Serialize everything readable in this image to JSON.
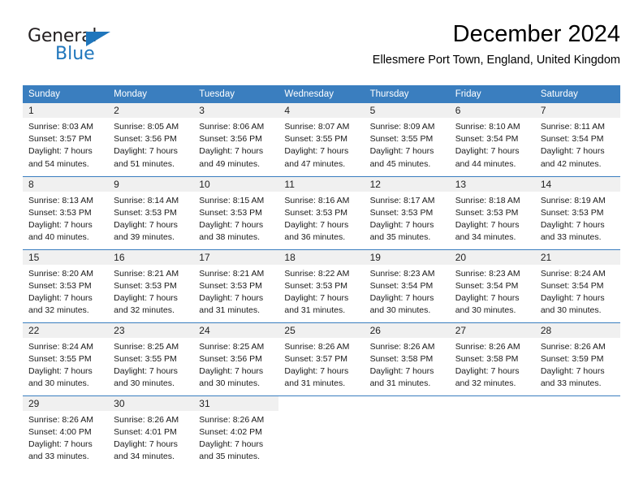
{
  "logo": {
    "word_dark": "General",
    "word_blue": "Blue",
    "accent_color": "#1f76bc"
  },
  "header": {
    "title": "December 2024",
    "subtitle": "Ellesmere Port Town, England, United Kingdom"
  },
  "calendar": {
    "header_bg": "#3a7ebf",
    "daynum_bg": "#f0f0f0",
    "weekdays": [
      "Sunday",
      "Monday",
      "Tuesday",
      "Wednesday",
      "Thursday",
      "Friday",
      "Saturday"
    ],
    "weeks": [
      [
        {
          "day": "1",
          "sunrise": "Sunrise: 8:03 AM",
          "sunset": "Sunset: 3:57 PM",
          "daylight1": "Daylight: 7 hours",
          "daylight2": "and 54 minutes."
        },
        {
          "day": "2",
          "sunrise": "Sunrise: 8:05 AM",
          "sunset": "Sunset: 3:56 PM",
          "daylight1": "Daylight: 7 hours",
          "daylight2": "and 51 minutes."
        },
        {
          "day": "3",
          "sunrise": "Sunrise: 8:06 AM",
          "sunset": "Sunset: 3:56 PM",
          "daylight1": "Daylight: 7 hours",
          "daylight2": "and 49 minutes."
        },
        {
          "day": "4",
          "sunrise": "Sunrise: 8:07 AM",
          "sunset": "Sunset: 3:55 PM",
          "daylight1": "Daylight: 7 hours",
          "daylight2": "and 47 minutes."
        },
        {
          "day": "5",
          "sunrise": "Sunrise: 8:09 AM",
          "sunset": "Sunset: 3:55 PM",
          "daylight1": "Daylight: 7 hours",
          "daylight2": "and 45 minutes."
        },
        {
          "day": "6",
          "sunrise": "Sunrise: 8:10 AM",
          "sunset": "Sunset: 3:54 PM",
          "daylight1": "Daylight: 7 hours",
          "daylight2": "and 44 minutes."
        },
        {
          "day": "7",
          "sunrise": "Sunrise: 8:11 AM",
          "sunset": "Sunset: 3:54 PM",
          "daylight1": "Daylight: 7 hours",
          "daylight2": "and 42 minutes."
        }
      ],
      [
        {
          "day": "8",
          "sunrise": "Sunrise: 8:13 AM",
          "sunset": "Sunset: 3:53 PM",
          "daylight1": "Daylight: 7 hours",
          "daylight2": "and 40 minutes."
        },
        {
          "day": "9",
          "sunrise": "Sunrise: 8:14 AM",
          "sunset": "Sunset: 3:53 PM",
          "daylight1": "Daylight: 7 hours",
          "daylight2": "and 39 minutes."
        },
        {
          "day": "10",
          "sunrise": "Sunrise: 8:15 AM",
          "sunset": "Sunset: 3:53 PM",
          "daylight1": "Daylight: 7 hours",
          "daylight2": "and 38 minutes."
        },
        {
          "day": "11",
          "sunrise": "Sunrise: 8:16 AM",
          "sunset": "Sunset: 3:53 PM",
          "daylight1": "Daylight: 7 hours",
          "daylight2": "and 36 minutes."
        },
        {
          "day": "12",
          "sunrise": "Sunrise: 8:17 AM",
          "sunset": "Sunset: 3:53 PM",
          "daylight1": "Daylight: 7 hours",
          "daylight2": "and 35 minutes."
        },
        {
          "day": "13",
          "sunrise": "Sunrise: 8:18 AM",
          "sunset": "Sunset: 3:53 PM",
          "daylight1": "Daylight: 7 hours",
          "daylight2": "and 34 minutes."
        },
        {
          "day": "14",
          "sunrise": "Sunrise: 8:19 AM",
          "sunset": "Sunset: 3:53 PM",
          "daylight1": "Daylight: 7 hours",
          "daylight2": "and 33 minutes."
        }
      ],
      [
        {
          "day": "15",
          "sunrise": "Sunrise: 8:20 AM",
          "sunset": "Sunset: 3:53 PM",
          "daylight1": "Daylight: 7 hours",
          "daylight2": "and 32 minutes."
        },
        {
          "day": "16",
          "sunrise": "Sunrise: 8:21 AM",
          "sunset": "Sunset: 3:53 PM",
          "daylight1": "Daylight: 7 hours",
          "daylight2": "and 32 minutes."
        },
        {
          "day": "17",
          "sunrise": "Sunrise: 8:21 AM",
          "sunset": "Sunset: 3:53 PM",
          "daylight1": "Daylight: 7 hours",
          "daylight2": "and 31 minutes."
        },
        {
          "day": "18",
          "sunrise": "Sunrise: 8:22 AM",
          "sunset": "Sunset: 3:53 PM",
          "daylight1": "Daylight: 7 hours",
          "daylight2": "and 31 minutes."
        },
        {
          "day": "19",
          "sunrise": "Sunrise: 8:23 AM",
          "sunset": "Sunset: 3:54 PM",
          "daylight1": "Daylight: 7 hours",
          "daylight2": "and 30 minutes."
        },
        {
          "day": "20",
          "sunrise": "Sunrise: 8:23 AM",
          "sunset": "Sunset: 3:54 PM",
          "daylight1": "Daylight: 7 hours",
          "daylight2": "and 30 minutes."
        },
        {
          "day": "21",
          "sunrise": "Sunrise: 8:24 AM",
          "sunset": "Sunset: 3:54 PM",
          "daylight1": "Daylight: 7 hours",
          "daylight2": "and 30 minutes."
        }
      ],
      [
        {
          "day": "22",
          "sunrise": "Sunrise: 8:24 AM",
          "sunset": "Sunset: 3:55 PM",
          "daylight1": "Daylight: 7 hours",
          "daylight2": "and 30 minutes."
        },
        {
          "day": "23",
          "sunrise": "Sunrise: 8:25 AM",
          "sunset": "Sunset: 3:55 PM",
          "daylight1": "Daylight: 7 hours",
          "daylight2": "and 30 minutes."
        },
        {
          "day": "24",
          "sunrise": "Sunrise: 8:25 AM",
          "sunset": "Sunset: 3:56 PM",
          "daylight1": "Daylight: 7 hours",
          "daylight2": "and 30 minutes."
        },
        {
          "day": "25",
          "sunrise": "Sunrise: 8:26 AM",
          "sunset": "Sunset: 3:57 PM",
          "daylight1": "Daylight: 7 hours",
          "daylight2": "and 31 minutes."
        },
        {
          "day": "26",
          "sunrise": "Sunrise: 8:26 AM",
          "sunset": "Sunset: 3:58 PM",
          "daylight1": "Daylight: 7 hours",
          "daylight2": "and 31 minutes."
        },
        {
          "day": "27",
          "sunrise": "Sunrise: 8:26 AM",
          "sunset": "Sunset: 3:58 PM",
          "daylight1": "Daylight: 7 hours",
          "daylight2": "and 32 minutes."
        },
        {
          "day": "28",
          "sunrise": "Sunrise: 8:26 AM",
          "sunset": "Sunset: 3:59 PM",
          "daylight1": "Daylight: 7 hours",
          "daylight2": "and 33 minutes."
        }
      ],
      [
        {
          "day": "29",
          "sunrise": "Sunrise: 8:26 AM",
          "sunset": "Sunset: 4:00 PM",
          "daylight1": "Daylight: 7 hours",
          "daylight2": "and 33 minutes."
        },
        {
          "day": "30",
          "sunrise": "Sunrise: 8:26 AM",
          "sunset": "Sunset: 4:01 PM",
          "daylight1": "Daylight: 7 hours",
          "daylight2": "and 34 minutes."
        },
        {
          "day": "31",
          "sunrise": "Sunrise: 8:26 AM",
          "sunset": "Sunset: 4:02 PM",
          "daylight1": "Daylight: 7 hours",
          "daylight2": "and 35 minutes."
        },
        {
          "day": "",
          "sunrise": "",
          "sunset": "",
          "daylight1": "",
          "daylight2": ""
        },
        {
          "day": "",
          "sunrise": "",
          "sunset": "",
          "daylight1": "",
          "daylight2": ""
        },
        {
          "day": "",
          "sunrise": "",
          "sunset": "",
          "daylight1": "",
          "daylight2": ""
        },
        {
          "day": "",
          "sunrise": "",
          "sunset": "",
          "daylight1": "",
          "daylight2": ""
        }
      ]
    ]
  }
}
